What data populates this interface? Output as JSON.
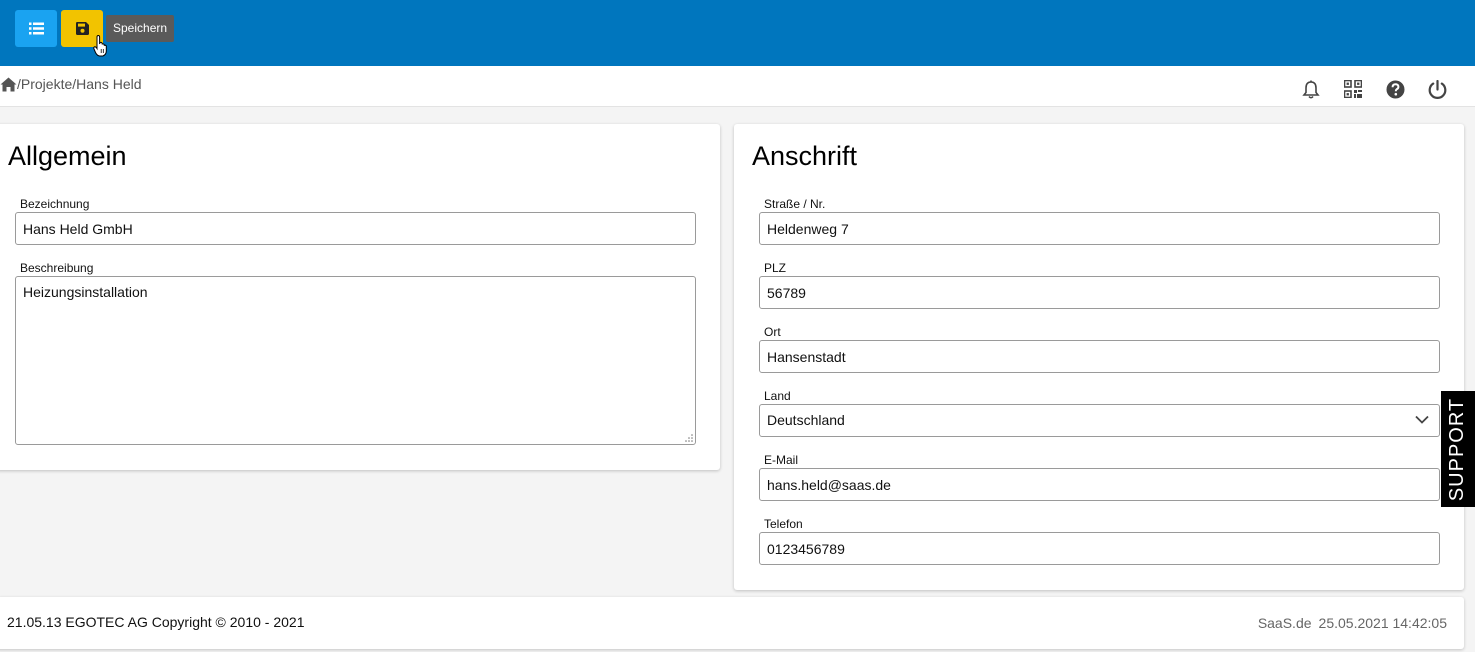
{
  "toolbar": {
    "list_icon": "list-icon",
    "save_icon": "floppy-disk-icon",
    "save_tooltip": "Speichern",
    "colors": {
      "bar": "#0076be",
      "list_button": "#1aa3f1",
      "save_button": "#f2c300"
    }
  },
  "breadcrumb": {
    "home_icon": "home-icon",
    "path": "/Projekte/Hans Held"
  },
  "header_icons": [
    "bell-icon",
    "qr-code-icon",
    "help-icon",
    "power-icon"
  ],
  "allgemein": {
    "title": "Allgemein",
    "bezeichnung": {
      "label": "Bezeichnung",
      "value": "Hans Held GmbH"
    },
    "beschreibung": {
      "label": "Beschreibung",
      "value": "Heizungsinstallation"
    }
  },
  "anschrift": {
    "title": "Anschrift",
    "strasse": {
      "label": "Straße / Nr.",
      "value": "Heldenweg 7"
    },
    "plz": {
      "label": "PLZ",
      "value": "56789"
    },
    "ort": {
      "label": "Ort",
      "value": "Hansenstadt"
    },
    "land": {
      "label": "Land",
      "value": "Deutschland"
    },
    "email": {
      "label": "E-Mail",
      "value": "hans.held@saas.de"
    },
    "telefon": {
      "label": "Telefon",
      "value": "0123456789"
    }
  },
  "support_tab": "SUPPORT",
  "footer": {
    "copyright": "21.05.13 EGOTEC AG Copyright © 2010 - 2021",
    "site": "SaaS.de",
    "datetime": "25.05.2021 14:42:05"
  }
}
